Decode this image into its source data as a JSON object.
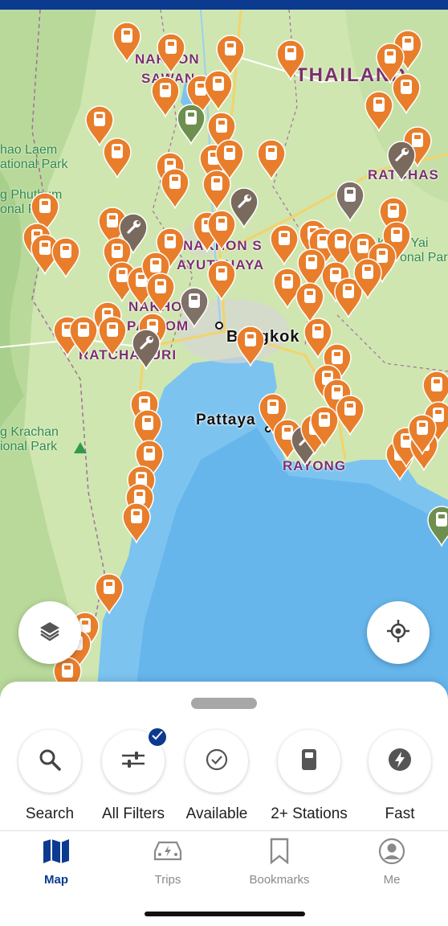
{
  "map": {
    "labels": {
      "country": "THAILAND",
      "nakhon_sawan_1": "NAKHON",
      "nakhon_sawan_2": "SAWAN",
      "nakhon_nayok": "NAKHON S",
      "ayutthaya": "AYUTTHAYA",
      "nakhon_pathom_1": "NAKHO",
      "nakhon_pathom_2": "PATHOM",
      "ratchaburi": "RATCHABURI",
      "ratchasima": "RATCHAS",
      "bangkok": "Bangkok",
      "pattaya": "Pattaya",
      "rayong": "RAYONG",
      "park_khao_laem_1": "hao Laem",
      "park_khao_laem_2": "ational Park",
      "park_phu_thum_1": "g Phuthum",
      "park_phu_thum_2": "onal P",
      "park_krachan_1": "g Krachan",
      "park_krachan_2": "ional Park",
      "park_right_1": "Khao Yai",
      "park_right_2": "onal Par"
    },
    "pin_colors": {
      "charger": "#e87e2b",
      "repair": "#7a6a5e",
      "grey": "#7f7068",
      "green": "#6f8f4f"
    }
  },
  "controls": {
    "layers_icon": "layers-icon",
    "locate_icon": "locate-icon"
  },
  "filters": [
    {
      "label": "Search",
      "icon": "search-icon"
    },
    {
      "label": "All Filters",
      "icon": "sliders-icon"
    },
    {
      "label": "Available",
      "icon": "check-circle-icon"
    },
    {
      "label": "2+ Stations",
      "icon": "fuel-pump-icon"
    },
    {
      "label": "Fast",
      "icon": "bolt-icon"
    }
  ],
  "tabs": [
    {
      "label": "Map",
      "icon": "map-icon",
      "active": true
    },
    {
      "label": "Trips",
      "icon": "car-icon",
      "active": false
    },
    {
      "label": "Bookmarks",
      "icon": "bookmark-icon",
      "active": false
    },
    {
      "label": "Me",
      "icon": "user-icon",
      "active": false
    }
  ],
  "colors": {
    "accent": "#0b3a8f",
    "sea": "#7cc3f0",
    "land": "#cfe6b0"
  }
}
